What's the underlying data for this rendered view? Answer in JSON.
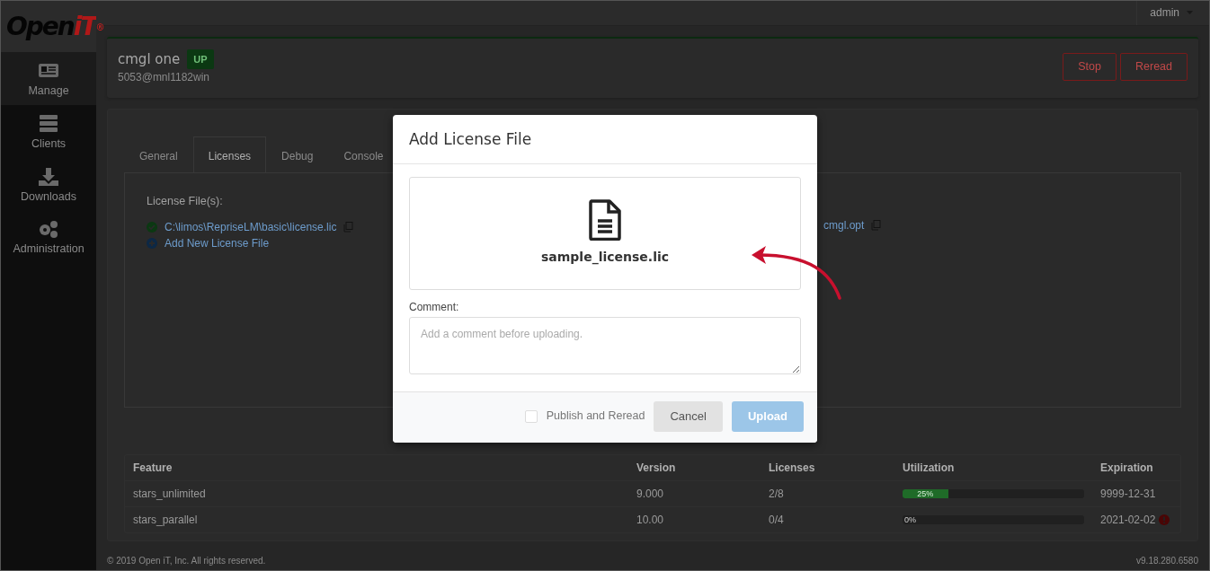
{
  "brand": {
    "name": "Open",
    "accent": "iT",
    "mark": "®"
  },
  "topbar": {
    "user": "admin"
  },
  "sidebar": {
    "items": [
      {
        "label": "Manage",
        "selected": true
      },
      {
        "label": "Clients",
        "selected": false
      },
      {
        "label": "Downloads",
        "selected": false
      },
      {
        "label": "Administration",
        "selected": false
      }
    ]
  },
  "server": {
    "name": "cmgl one",
    "status": "UP",
    "address": "5053@mnl1182win",
    "buttons": [
      "Stop",
      "Reread"
    ]
  },
  "tabs": [
    {
      "label": "General",
      "selected": false
    },
    {
      "label": "Licenses",
      "selected": true
    },
    {
      "label": "Debug",
      "selected": false
    },
    {
      "label": "Console",
      "selected": false
    }
  ],
  "licenses": {
    "heading": "License File(s):",
    "files": [
      {
        "path": "C:\\limos\\RepriseLM\\basic\\license.lic",
        "valid": true
      }
    ],
    "add_link": "Add New License File",
    "options_file": "cmgl.opt"
  },
  "table": {
    "columns": [
      "Feature",
      "Version",
      "Licenses",
      "Utilization",
      "Expiration"
    ],
    "rows": [
      {
        "feature": "stars_unlimited",
        "version": "9.000",
        "licenses": "2/8",
        "level": 0.25,
        "utilization": "25%",
        "expiration": "9999-12-31",
        "expired": false
      },
      {
        "feature": "stars_parallel",
        "version": "10.00",
        "licenses": "0/4",
        "level": 0,
        "utilization": "0%",
        "expiration": "2021-02-02",
        "expired": true
      }
    ]
  },
  "modal": {
    "title": "Add License File",
    "file_name": "sample_license.lic",
    "comment_label": "Comment:",
    "comment_placeholder": "Add a comment before uploading.",
    "publish": {
      "label": "Publish and Reread",
      "checked": false
    },
    "buttons": [
      {
        "label": "Cancel",
        "kind": "secondary",
        "disabled": false
      },
      {
        "label": "Upload",
        "kind": "primary",
        "disabled": true
      }
    ]
  },
  "footer": {
    "copyright": "© 2019 Open iT, Inc. All rights reserved.",
    "version": "v9.18.280.6580"
  }
}
